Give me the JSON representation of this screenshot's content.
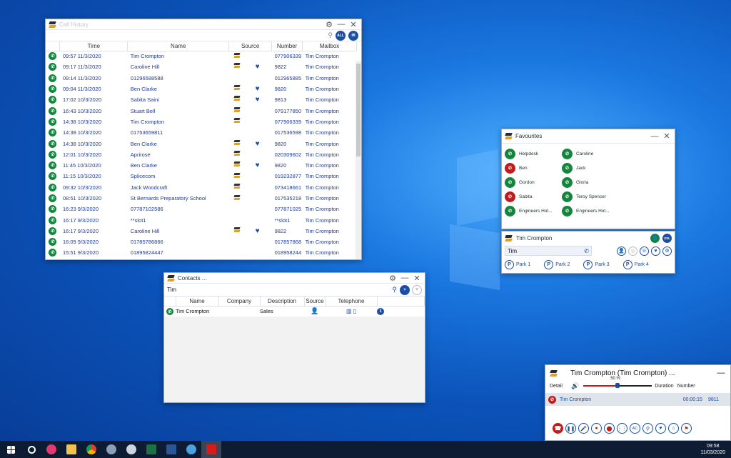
{
  "call_history": {
    "title": "Call History",
    "filter_all": "ALL",
    "columns": [
      "Time",
      "Name",
      "Source",
      "Number",
      "Mailbox"
    ],
    "rows": [
      {
        "time": "09:57 11/3/2020",
        "name": "Tim Crompton",
        "src": true,
        "fav": false,
        "number": "077906339",
        "mailbox": "Tim Crompton"
      },
      {
        "time": "09:17 11/3/2020",
        "name": "Caroline Hill",
        "src": true,
        "fav": true,
        "number": "9822",
        "mailbox": "Tim Crompton"
      },
      {
        "time": "09:14 11/3/2020",
        "name": "01296588588",
        "src": false,
        "fav": false,
        "number": "012965885",
        "mailbox": "Tim Crompton"
      },
      {
        "time": "09:04 11/3/2020",
        "name": "Ben Clarke",
        "src": true,
        "fav": true,
        "number": "9820",
        "mailbox": "Tim Crompton"
      },
      {
        "time": "17:02 10/3/2020",
        "name": "Sabita Saini",
        "src": true,
        "fav": true,
        "number": "9813",
        "mailbox": "Tim Crompton"
      },
      {
        "time": "16:43 10/3/2020",
        "name": "Stuart Bell",
        "src": true,
        "fav": false,
        "number": "079177850",
        "mailbox": "Tim Crompton"
      },
      {
        "time": "14:38 10/3/2020",
        "name": "Tim Crompton",
        "src": true,
        "fav": false,
        "number": "077906339",
        "mailbox": "Tim Crompton"
      },
      {
        "time": "14:38 10/3/2020",
        "name": "01753659811",
        "src": false,
        "fav": false,
        "number": "017536598",
        "mailbox": "Tim Crompton"
      },
      {
        "time": "14:38 10/3/2020",
        "name": "Ben Clarke",
        "src": true,
        "fav": true,
        "number": "9820",
        "mailbox": "Tim Crompton"
      },
      {
        "time": "12:01 10/3/2020",
        "name": "Aprirose",
        "src": true,
        "fav": false,
        "number": "020309602",
        "mailbox": "Tim Crompton"
      },
      {
        "time": "11:45 10/3/2020",
        "name": "Ben Clarke",
        "src": true,
        "fav": true,
        "number": "9820",
        "mailbox": "Tim Crompton"
      },
      {
        "time": "11:15 10/3/2020",
        "name": "Splicecom",
        "src": true,
        "fav": false,
        "number": "019232877",
        "mailbox": "Tim Crompton"
      },
      {
        "time": "09:32 10/3/2020",
        "name": "Jack Woodcraft",
        "src": true,
        "fav": false,
        "number": "073418661",
        "mailbox": "Tim Crompton"
      },
      {
        "time": "08:51 10/3/2020",
        "name": "St Bernards Preparatory School",
        "src": true,
        "fav": false,
        "number": "017535218",
        "mailbox": "Tim Crompton"
      },
      {
        "time": "16:23 9/3/2020",
        "name": "07787102586",
        "src": false,
        "fav": false,
        "number": "077871025",
        "mailbox": "Tim Crompton"
      },
      {
        "time": "16:17 9/3/2020",
        "name": "**slot1",
        "src": false,
        "fav": false,
        "number": "**slot1",
        "mailbox": "Tim Crompton"
      },
      {
        "time": "16:17 9/3/2020",
        "name": "Caroline Hill",
        "src": true,
        "fav": true,
        "number": "9822",
        "mailbox": "Tim Crompton"
      },
      {
        "time": "16:09 9/3/2020",
        "name": "01785786866",
        "src": false,
        "fav": false,
        "number": "017857868",
        "mailbox": "Tim Crompton"
      },
      {
        "time": "15:51 9/3/2020",
        "name": "01895824447",
        "src": false,
        "fav": false,
        "number": "018958244",
        "mailbox": "Tim Crompton"
      }
    ]
  },
  "contacts": {
    "title": "Contacts ...",
    "search_value": "Tim",
    "columns": [
      "Name",
      "Company",
      "Description",
      "Source",
      "Telephone"
    ],
    "row": {
      "name": "Tim Crompton",
      "company": "",
      "description": "Sales",
      "badge": "1"
    }
  },
  "favourites": {
    "title": "Favourites",
    "items": [
      {
        "label": "Helpdesk",
        "status": "green"
      },
      {
        "label": "Caroline",
        "status": "green"
      },
      {
        "label": "Ben",
        "status": "red"
      },
      {
        "label": "Jack",
        "status": "green"
      },
      {
        "label": "Gordon",
        "status": "green"
      },
      {
        "label": "Gloria",
        "status": "green"
      },
      {
        "label": "Sabita",
        "status": "red"
      },
      {
        "label": "Teroy Spencer",
        "status": "green"
      },
      {
        "label": "Engineers Hot...",
        "status": "green"
      },
      {
        "label": "Engineers Hot...",
        "status": "green"
      }
    ]
  },
  "user_panel": {
    "name": "Tim Crompton",
    "badge": "SSL",
    "search_value": "Tim",
    "parks": [
      "Park 1",
      "Park 2",
      "Park 3",
      "Park 4"
    ]
  },
  "call_panel": {
    "title": "Tim Crompton (Tim Crompton) ...",
    "detail_label": "Detail",
    "volume": "50 %",
    "volume_fraction": 0.5,
    "duration_label": "Duration",
    "number_label": "Number",
    "call_name": "Tim Crompton",
    "duration": "00:00:15",
    "number": "9811",
    "ac_label": "AC"
  },
  "clock": {
    "time": "09:58",
    "date": "11/03/2020"
  },
  "colors": {
    "accent": "#1a4fa3",
    "green": "#12863d",
    "red": "#c01c1c"
  }
}
